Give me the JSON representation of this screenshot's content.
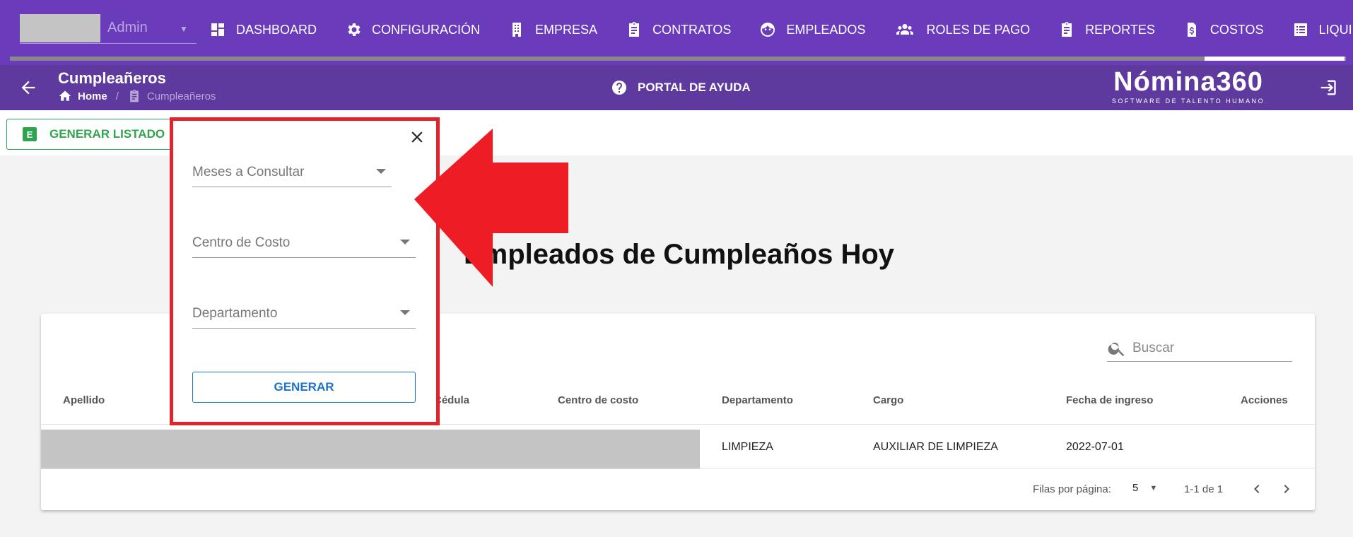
{
  "user": {
    "name": "Admin"
  },
  "nav": {
    "items": [
      {
        "label": "DASHBOARD",
        "icon": "dashboard-icon"
      },
      {
        "label": "CONFIGURACIÓN",
        "icon": "gear-icon"
      },
      {
        "label": "EMPRESA",
        "icon": "building-icon"
      },
      {
        "label": "CONTRATOS",
        "icon": "clipboard-icon"
      },
      {
        "label": "EMPLEADOS",
        "icon": "face-icon"
      },
      {
        "label": "ROLES DE PAGO",
        "icon": "people-icon"
      },
      {
        "label": "REPORTES",
        "icon": "clipboard-icon"
      },
      {
        "label": "COSTOS",
        "icon": "dollar-file-icon"
      },
      {
        "label": "LIQUIDACIONES",
        "icon": "list-icon"
      }
    ]
  },
  "header": {
    "title": "Cumpleañeros",
    "breadcrumb": {
      "home": "Home",
      "sep": "/",
      "current": "Cumpleañeros"
    },
    "help": "PORTAL DE AYUDA",
    "logo": {
      "main": "Nómina360",
      "sub": "SOFTWARE DE TALENTO HUMANO"
    }
  },
  "toolbar": {
    "generate_list": "GENERAR LISTADO",
    "excel_letter": "E"
  },
  "main": {
    "heading": "Empleados de Cumpleaños Hoy"
  },
  "table": {
    "search_placeholder": "Buscar",
    "columns": [
      "Apellido",
      "Cédula",
      "Centro de costo",
      "Departamento",
      "Cargo",
      "Fecha de ingreso",
      "Acciones"
    ],
    "rows": [
      {
        "departamento": "LIMPIEZA",
        "cargo": "AUXILIAR DE LIMPIEZA",
        "fecha_ingreso": "2022-07-01"
      }
    ],
    "footer": {
      "rows_per_page_label": "Filas por página:",
      "rows_per_page": "5",
      "range": "1-1 de 1"
    }
  },
  "popup": {
    "fields": [
      "Meses a Consultar",
      "Centro de Costo",
      "Departamento"
    ],
    "generate": "GENERAR"
  },
  "colors": {
    "nav": "#6a3cbc",
    "subheader": "#5f3a9e",
    "highlight": "#e0242b",
    "green": "#2fa44f",
    "blue": "#1a73c9"
  }
}
